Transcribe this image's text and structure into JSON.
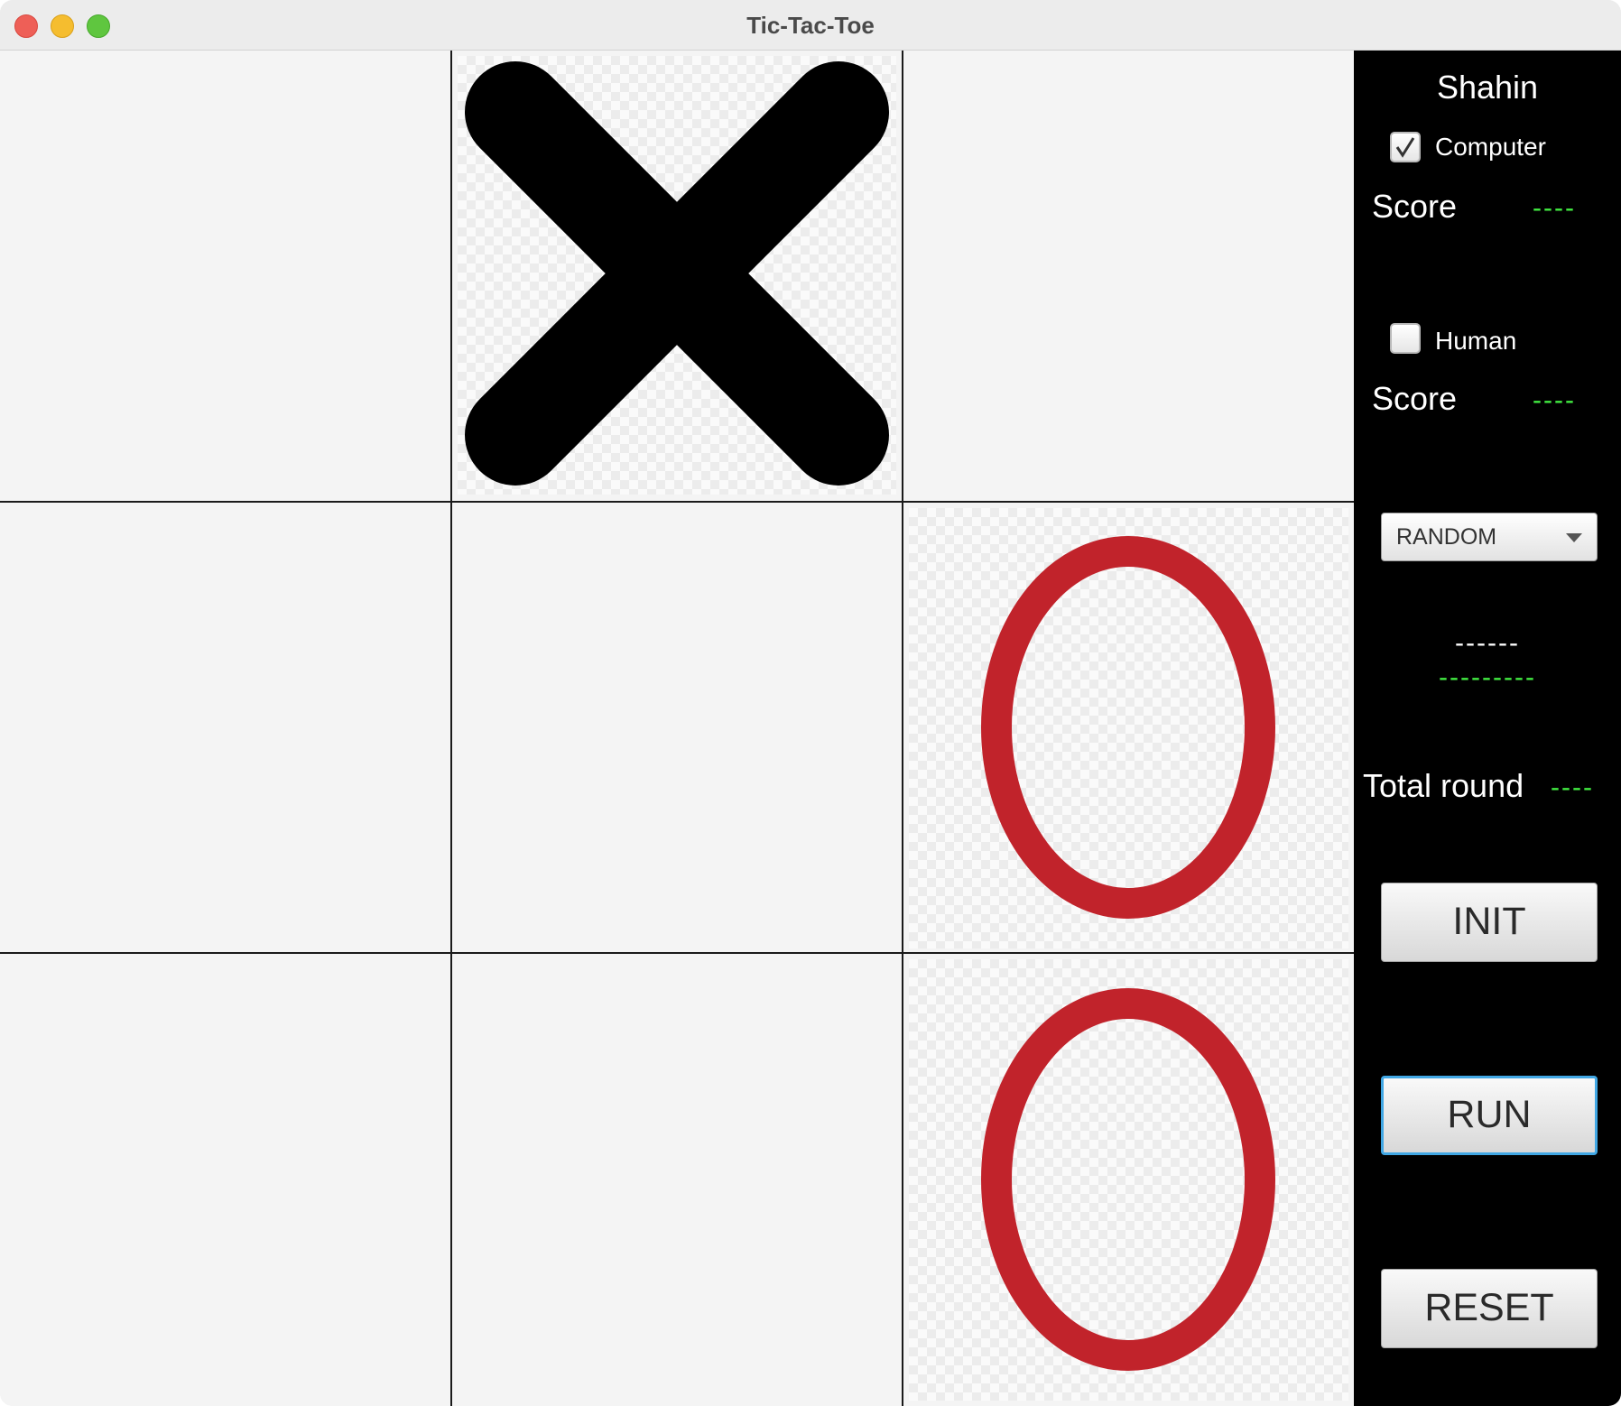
{
  "window": {
    "title": "Tic-Tac-Toe"
  },
  "board": {
    "cells": [
      "",
      "X",
      "",
      "",
      "",
      "O",
      "",
      "",
      "O"
    ]
  },
  "panel": {
    "player_name": "Shahin",
    "computer": {
      "label": "Computer",
      "checked": true,
      "score_label": "Score",
      "score_value": "----"
    },
    "human": {
      "label": "Human",
      "checked": false,
      "score_label": "Score",
      "score_value": "----"
    },
    "mode_select": {
      "value": "RANDOM"
    },
    "status_line1": "------",
    "status_line2": "---------",
    "total_round_label": "Total round",
    "total_round_value": "----",
    "init_label": "INIT",
    "run_label": "RUN",
    "reset_label": "RESET"
  },
  "colors": {
    "x_mark": "#000000",
    "o_mark": "#c1232b",
    "panel_bg": "#000000",
    "dash_green": "#43f043",
    "focus_ring": "#41a7e4"
  }
}
